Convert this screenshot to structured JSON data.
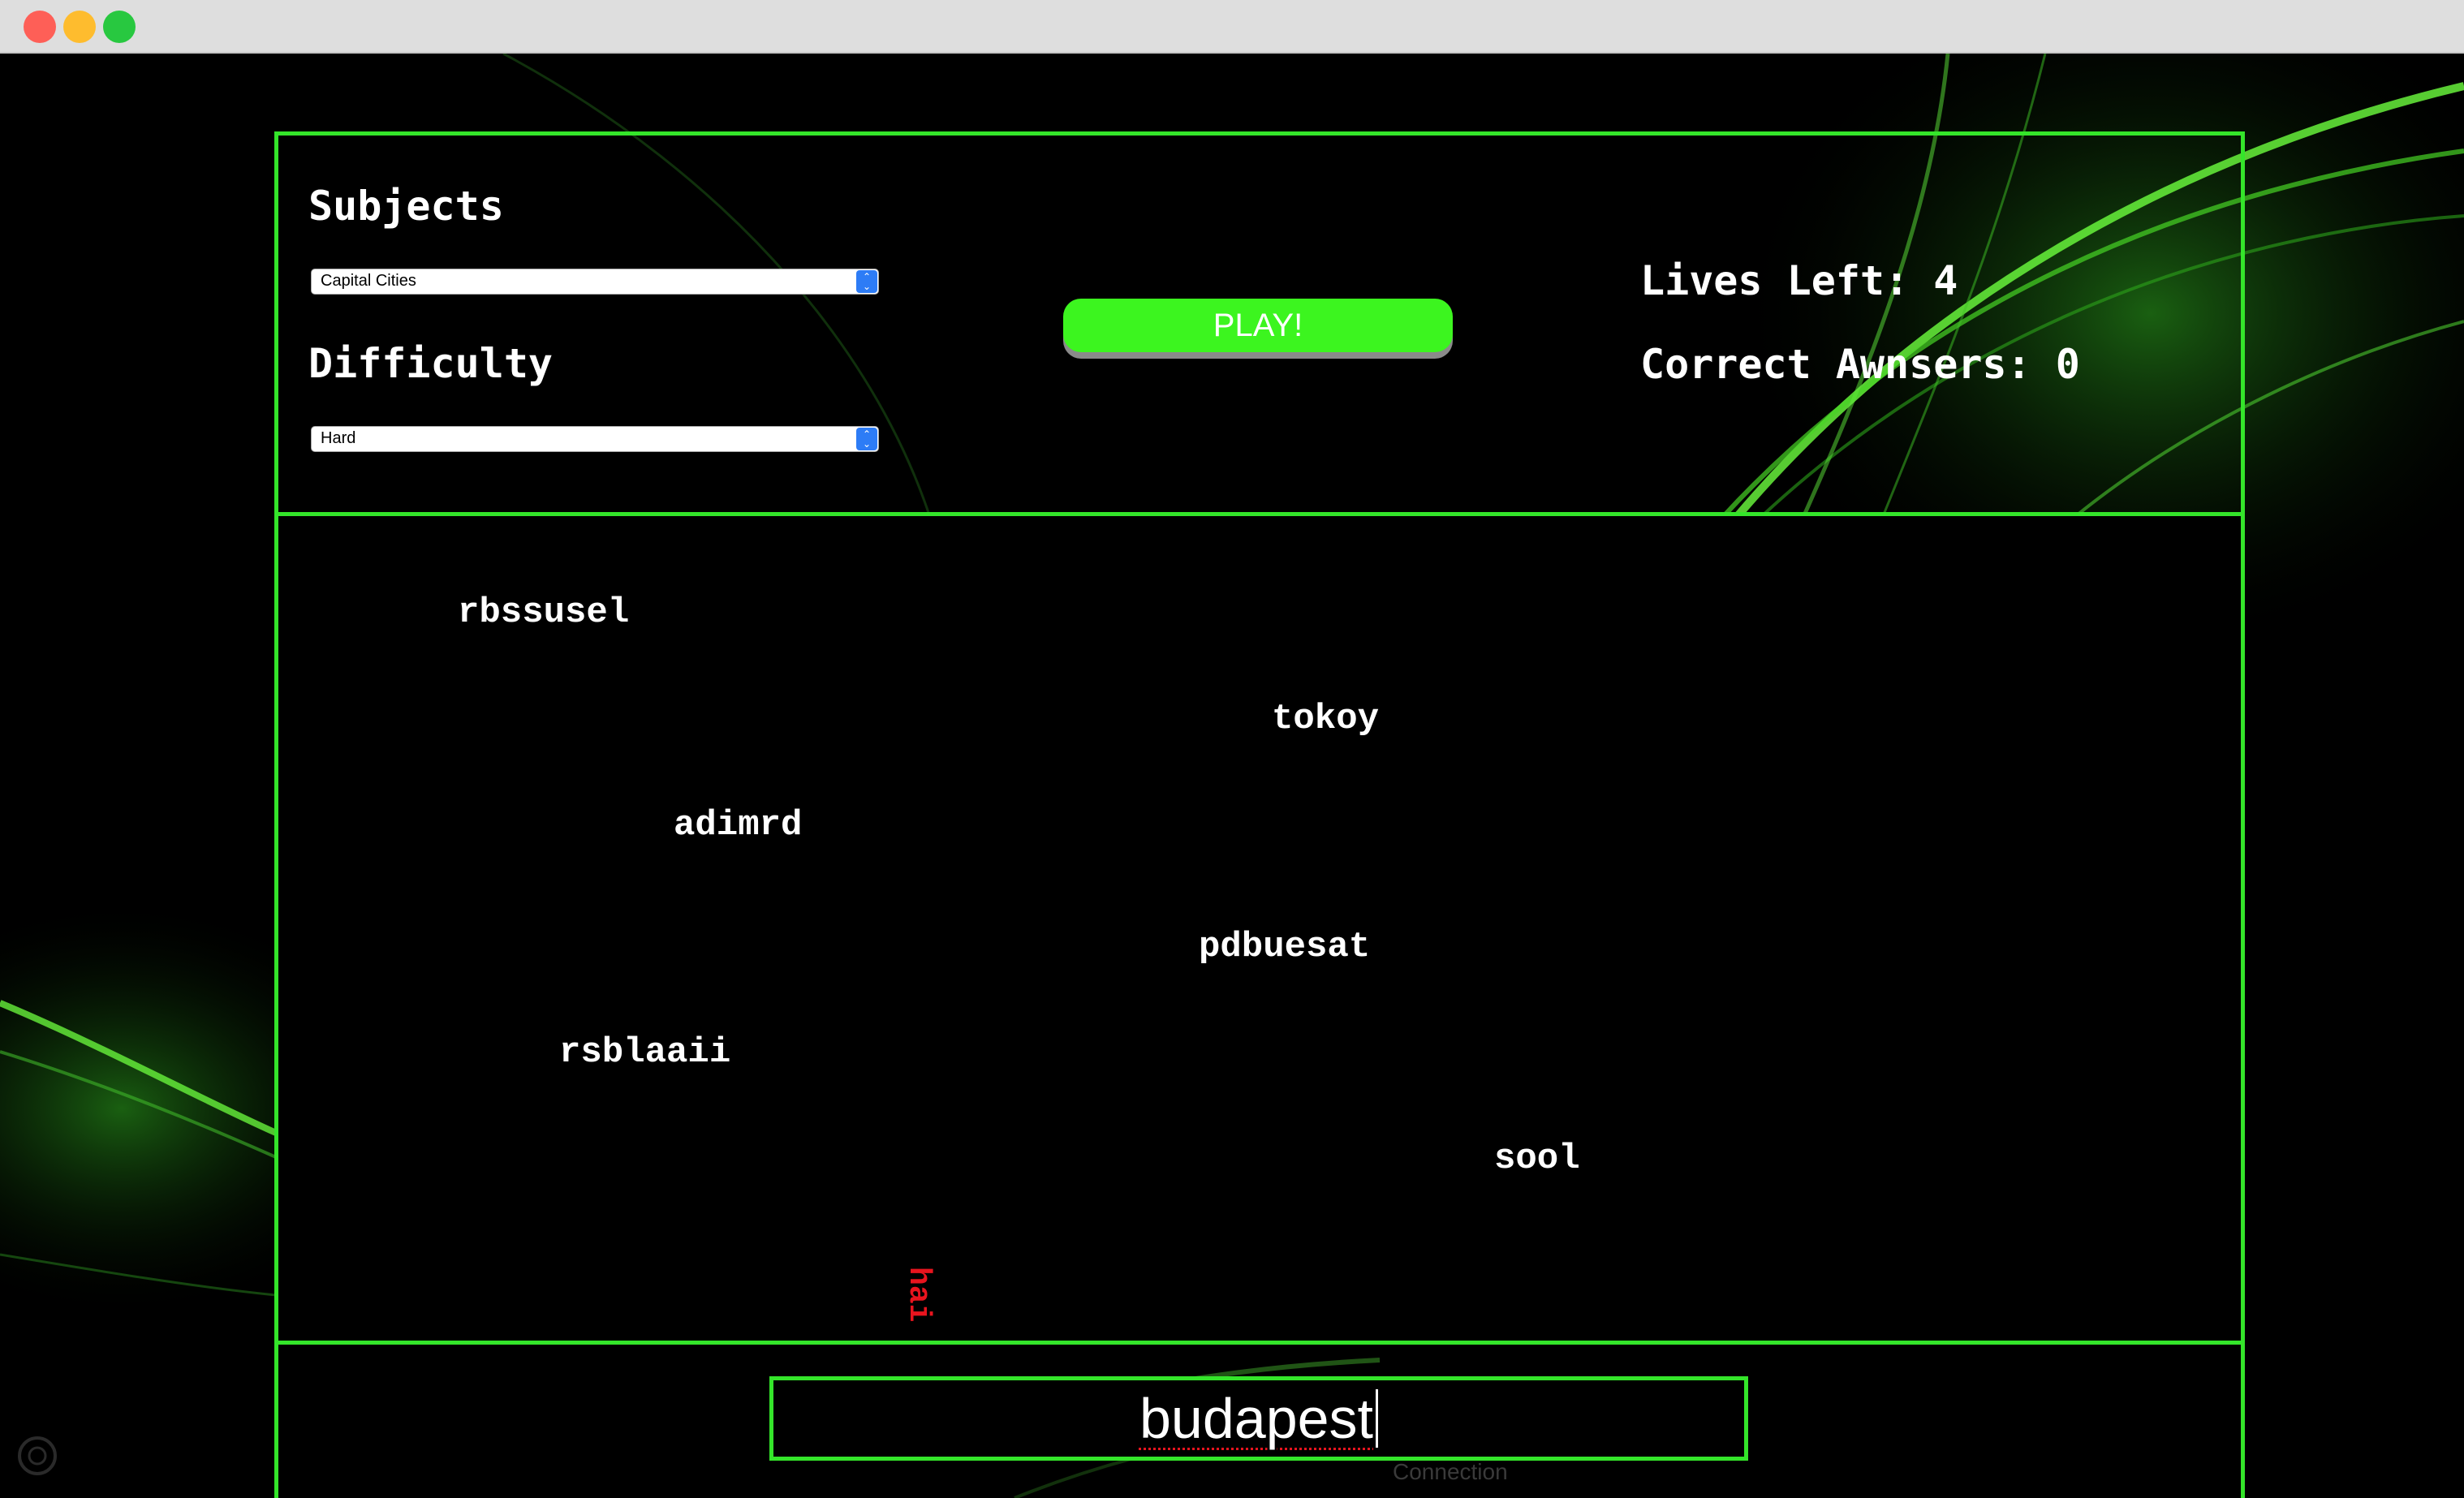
{
  "app": {
    "window_controls": [
      "close",
      "minimize",
      "zoom"
    ]
  },
  "settings": {
    "subjects_heading": "Subjects",
    "subject_selected": "Capital Cities",
    "difficulty_heading": "Difficulty",
    "difficulty_selected": "Hard"
  },
  "controls": {
    "play_label": "PLAY!"
  },
  "stats": {
    "lives_label": "Lives Left:",
    "lives_value": "4",
    "correct_label": "Correct Awnsers:",
    "correct_value": "0"
  },
  "words": [
    {
      "text": "rbssusel"
    },
    {
      "text": "tokoy"
    },
    {
      "text": "adimrd"
    },
    {
      "text": "pdbuesat"
    },
    {
      "text": "rsblaaii"
    },
    {
      "text": "sool"
    }
  ],
  "falling_word": "hai",
  "answer": {
    "value": "budapest"
  },
  "background": {
    "connection_label": "Connection"
  },
  "colors": {
    "accent": "#34e52a",
    "play_button": "#3cf51f",
    "falling_word": "#e8141e",
    "select_arrow": "#2d7cf6"
  }
}
